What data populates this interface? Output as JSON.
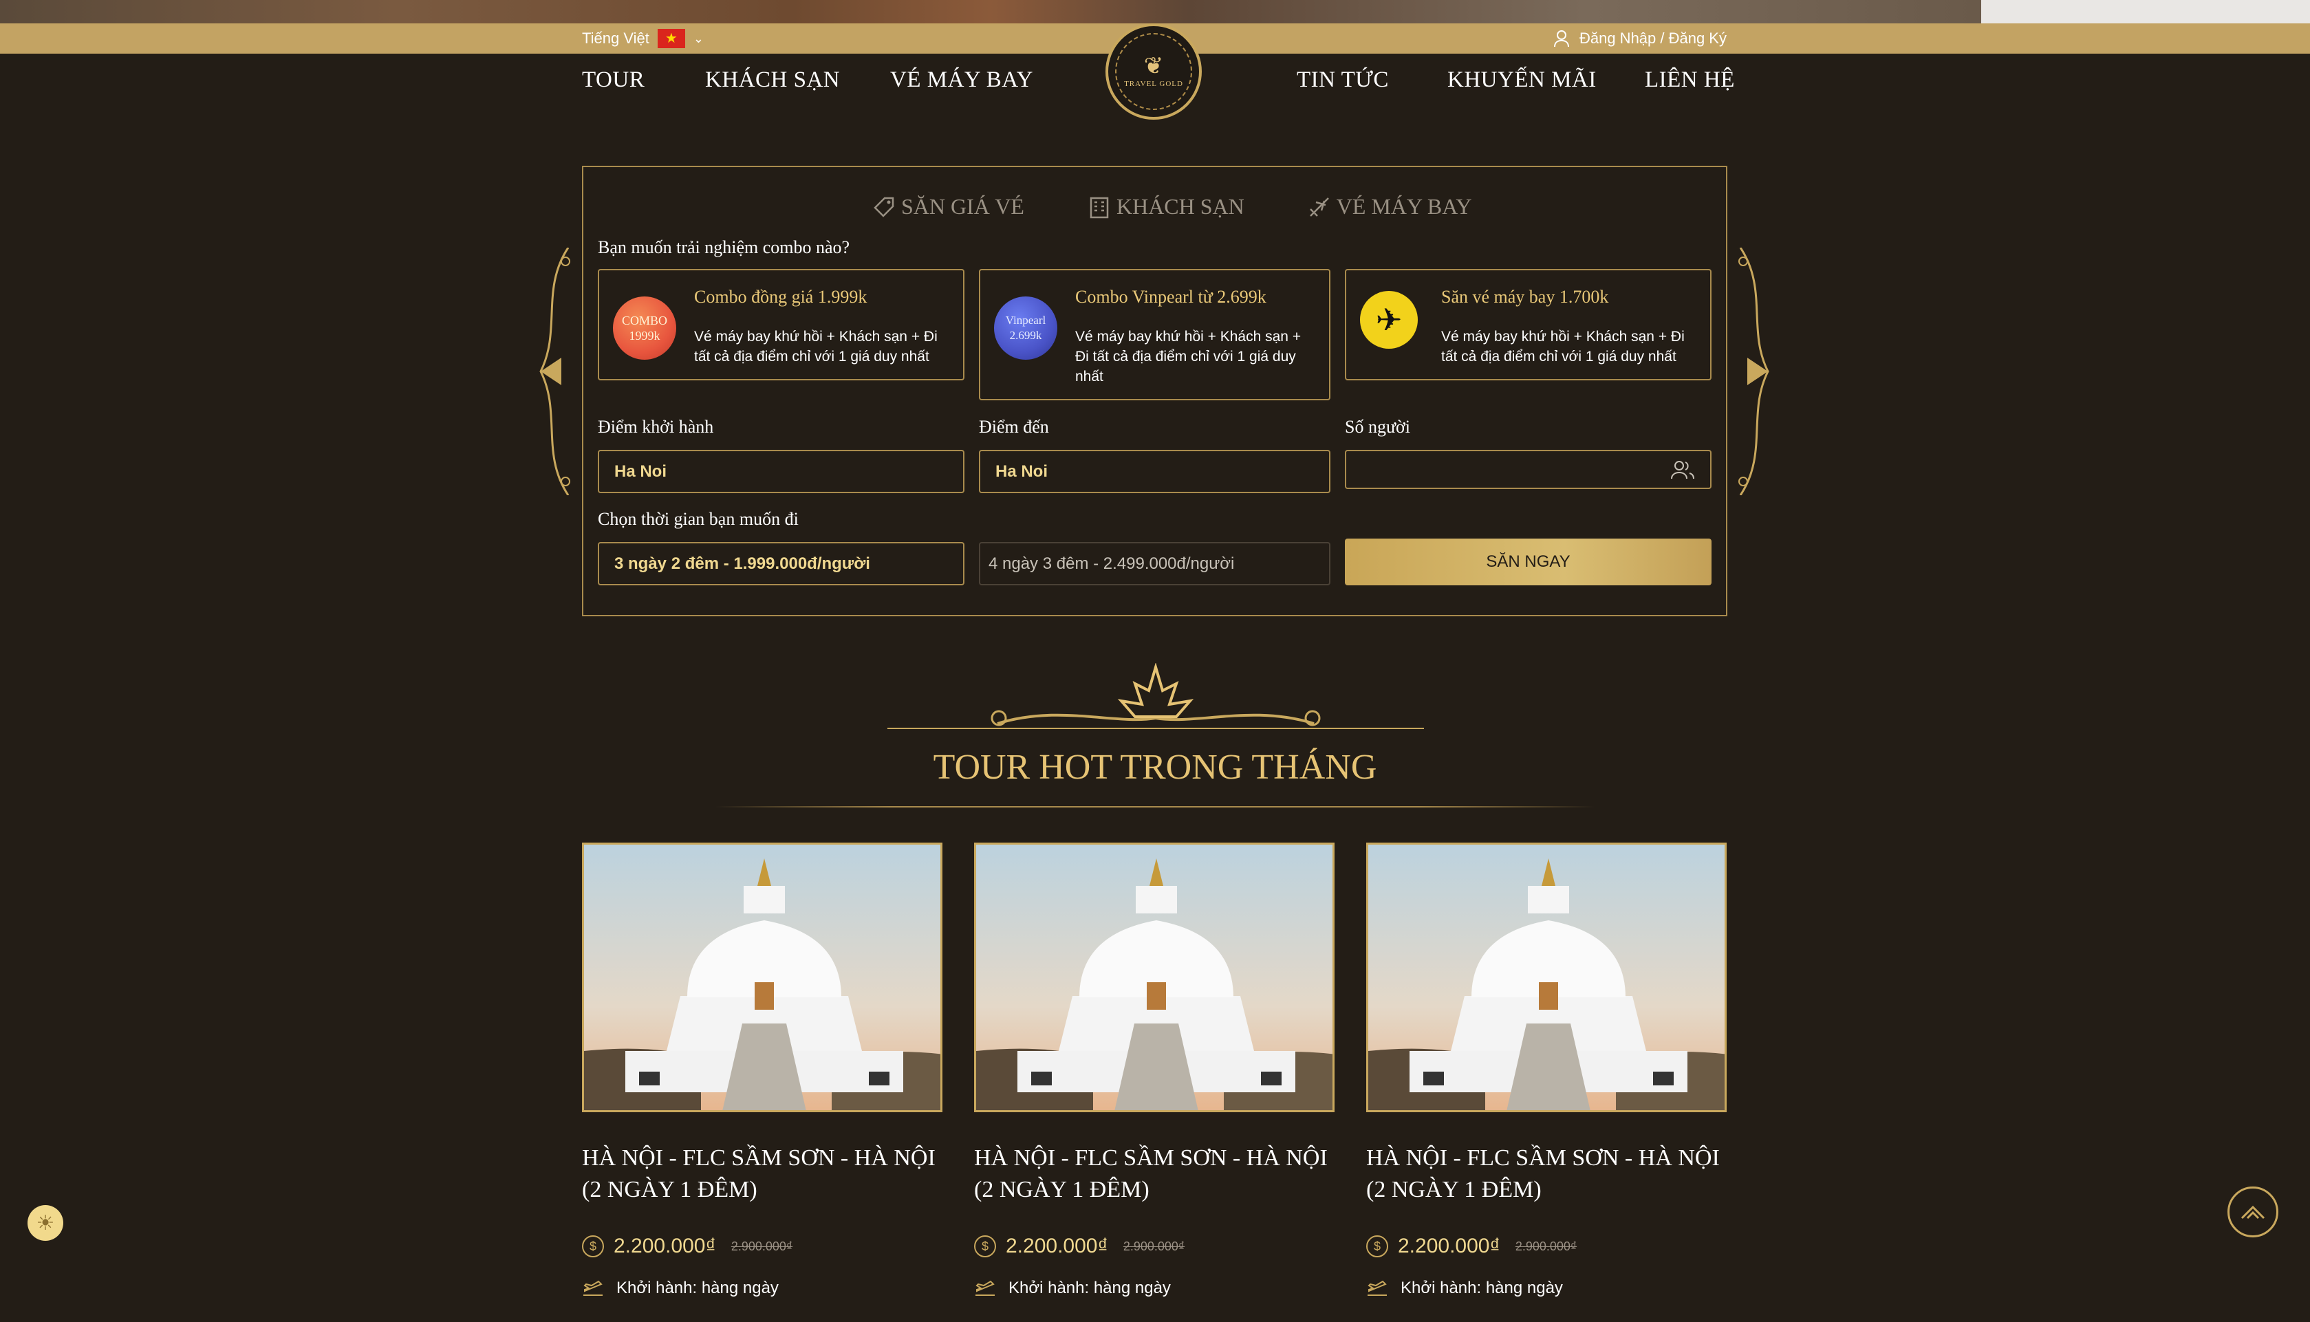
{
  "topbar": {
    "language": "Tiếng Việt",
    "flag_glyph": "★",
    "chevron": "⌄",
    "login_label": "Đăng Nhập / Đăng Ký"
  },
  "nav": {
    "left": [
      "TOUR",
      "KHÁCH SẠN",
      "VÉ MÁY BAY"
    ],
    "right": [
      "TIN TỨC",
      "KHUYẾN MÃI",
      "LIÊN HỆ"
    ]
  },
  "logo": {
    "mark": "❦",
    "text": "TRAVEL GOLD"
  },
  "search": {
    "tabs": [
      {
        "label": "SĂN GIÁ VÉ",
        "icon": "tag-icon"
      },
      {
        "label": "KHÁCH SẠN",
        "icon": "hotel-icon"
      },
      {
        "label": "VÉ MÁY BAY",
        "icon": "plane-icon"
      }
    ],
    "question": "Bạn muốn trải nghiệm combo nào?",
    "combos": [
      {
        "title": "Combo đồng giá 1.999k",
        "desc": "Vé máy bay khứ hồi + Khách sạn + Đi tất cả địa điểm chỉ với 1 giá duy nhất",
        "badge": "COMBO\n1999k",
        "color": "#e8563e"
      },
      {
        "title": "Combo Vinpearl từ 2.699k",
        "desc": "Vé máy bay khứ hồi + Khách sạn + Đi tất cả địa điểm chỉ với 1 giá duy nhất",
        "badge": "Vinpearl\n2.699k",
        "color": "#4a54c8"
      },
      {
        "title": "Săn vé máy bay 1.700k",
        "desc": "Vé máy bay khứ hồi + Khách sạn + Đi tất cả địa điểm chỉ với 1 giá duy nhất",
        "badge": "✈",
        "color": "#f2d21b"
      }
    ],
    "departure_label": "Điểm khởi hành",
    "departure_value": "Ha Noi",
    "destination_label": "Điểm đến",
    "destination_value": "Ha Noi",
    "people_label": "Số người",
    "people_value": "",
    "time_label": "Chọn thời gian bạn muốn đi",
    "time_options": [
      "3 ngày 2 đêm - 1.999.000đ/người",
      "4 ngày 3 đêm - 2.499.000đ/người"
    ],
    "submit_label": "SĂN NGAY"
  },
  "section": {
    "title": "TOUR HOT TRONG THÁNG"
  },
  "tours": [
    {
      "name_line1": "HÀ NỘI - FLC SẦM SƠN - HÀ NỘI",
      "name_line2": "(2 NGÀY 1 ĐÊM)",
      "price": "2.200.000₫",
      "old_price": "2.900.000₫",
      "departure": "Khởi hành: hàng ngày"
    },
    {
      "name_line1": "HÀ NỘI - FLC SẦM SƠN - HÀ NỘI",
      "name_line2": "(2 NGÀY 1 ĐÊM)",
      "price": "2.200.000₫",
      "old_price": "2.900.000₫",
      "departure": "Khởi hành: hàng ngày"
    },
    {
      "name_line1": "HÀ NỘI - FLC SẦM SƠN - HÀ NỘI",
      "name_line2": "(2 NGÀY 1 ĐÊM)",
      "price": "2.200.000₫",
      "old_price": "2.900.000₫",
      "departure": "Khởi hành: hàng ngày"
    }
  ],
  "coin_glyph": "$",
  "theme_glyph": "☀",
  "colors": {
    "background": "#231d16",
    "gold": "#c9a85d",
    "accent_text": "#e6c374",
    "topbar": "#c3a363"
  }
}
